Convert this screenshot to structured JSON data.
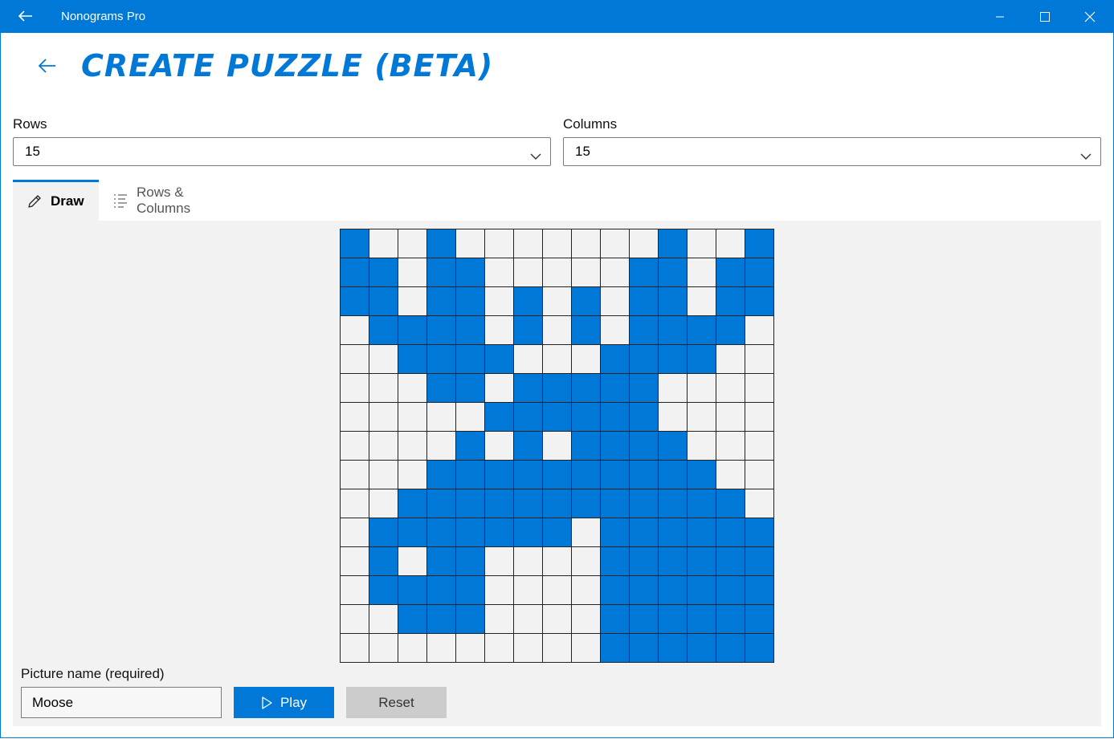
{
  "window": {
    "title": "Nonograms Pro"
  },
  "page": {
    "title": "CREATE PUZZLE (BETA)"
  },
  "rows_field": {
    "label": "Rows",
    "value": "15"
  },
  "columns_field": {
    "label": "Columns",
    "value": "15"
  },
  "tabs": [
    {
      "label": "Draw",
      "icon": "pencil-icon",
      "active": true
    },
    {
      "label": "Rows & Columns",
      "icon": "list-icon",
      "active": false
    }
  ],
  "grid": {
    "rows": 15,
    "columns": 15,
    "fill_color": "#0078d7",
    "empty_color": "#f2f2f2",
    "pattern": [
      "100100000001001",
      "110110000011011",
      "110110101011011",
      "011110101011110",
      "001111000111100",
      "000110111110000",
      "000001111110000",
      "000010101111000",
      "000111111111100",
      "001111111111110",
      "011111110111111",
      "010110000111111",
      "011110000111111",
      "001110000111111",
      "000000000111111"
    ]
  },
  "picture_name": {
    "label": "Picture name (required)",
    "value": "Moose"
  },
  "buttons": {
    "play": "Play",
    "reset": "Reset"
  },
  "colors": {
    "accent": "#0078d7",
    "panel": "#f2f2f2",
    "reset_bg": "#cccccc"
  }
}
